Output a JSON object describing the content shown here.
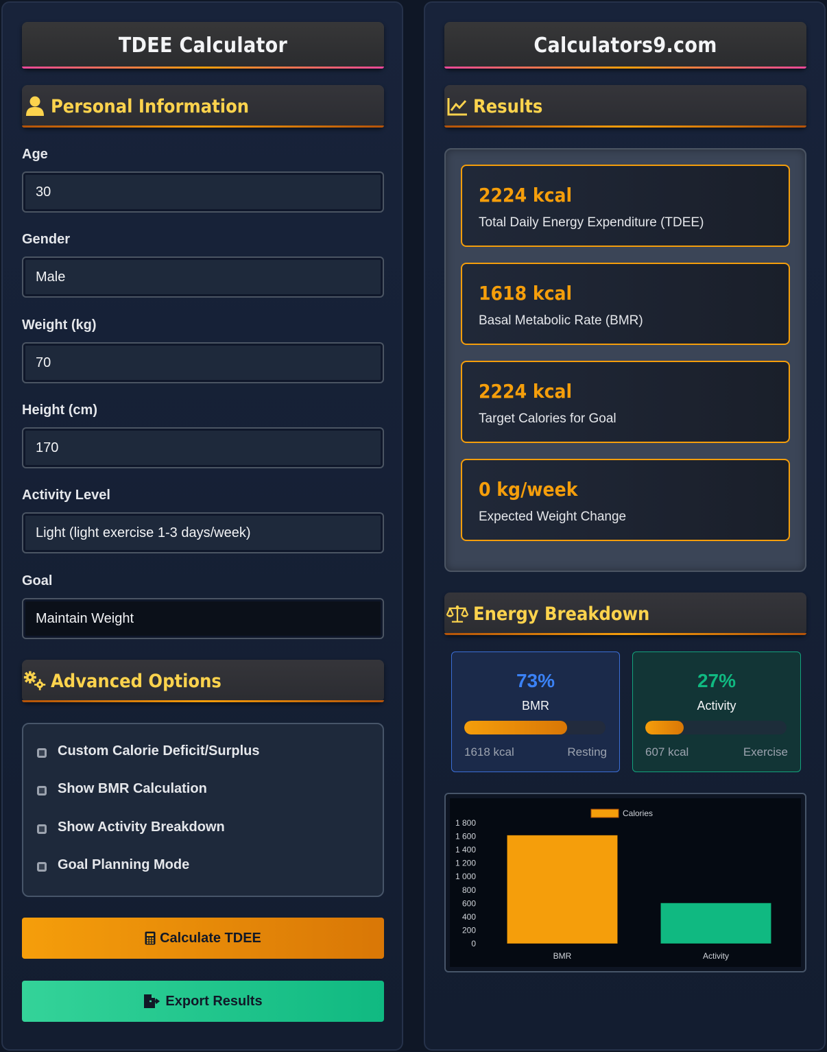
{
  "left": {
    "title": "TDEE Calculator",
    "personal_header": "Personal Information",
    "fields": [
      {
        "label": "Age",
        "value": "30"
      },
      {
        "label": "Gender",
        "value": "Male"
      },
      {
        "label": "Weight (kg)",
        "value": "70"
      },
      {
        "label": "Height (cm)",
        "value": "170"
      },
      {
        "label": "Activity Level",
        "value": "Light (light exercise 1-3 days/week)"
      },
      {
        "label": "Goal",
        "value": "Maintain Weight"
      }
    ],
    "advanced_header": "Advanced Options",
    "options": [
      {
        "label": "Custom Calorie Deficit/Surplus",
        "checked": false
      },
      {
        "label": "Show BMR Calculation",
        "checked": false
      },
      {
        "label": "Show Activity Breakdown",
        "checked": false
      },
      {
        "label": "Goal Planning Mode",
        "checked": false
      }
    ],
    "calculate_button": "Calculate TDEE",
    "export_button": "Export Results"
  },
  "right": {
    "title": "Calculators9.com",
    "results_header": "Results",
    "results": [
      {
        "value": "2224 kcal",
        "label": "Total Daily Energy Expenditure (TDEE)"
      },
      {
        "value": "1618 kcal",
        "label": "Basal Metabolic Rate (BMR)"
      },
      {
        "value": "2224 kcal",
        "label": "Target Calories for Goal"
      },
      {
        "value": "0 kg/week",
        "label": "Expected Weight Change"
      }
    ],
    "breakdown_header": "Energy Breakdown",
    "bmr_card": {
      "percent": "73%",
      "name": "BMR",
      "kcal": "1618 kcal",
      "tag": "Resting",
      "fill": 0.73
    },
    "activity_card": {
      "percent": "27%",
      "name": "Activity",
      "kcal": "607 kcal",
      "tag": "Exercise",
      "fill": 0.27
    }
  },
  "colors": {
    "accent": "#f59e0b",
    "bmr_blue": "#3b82f6",
    "activity_green": "#10b981",
    "panel_bg": "#18233a"
  },
  "chart_data": {
    "type": "bar",
    "categories": [
      "BMR",
      "Activity"
    ],
    "series": [
      {
        "name": "Calories",
        "values": [
          1618,
          607
        ],
        "colors": [
          "#f59e0b",
          "#10b981"
        ]
      }
    ],
    "ylim": [
      0,
      1800
    ],
    "yticks": [
      "1 800",
      "1 600",
      "1 400",
      "1 200",
      "1 000",
      "800",
      "600",
      "400",
      "200",
      "0"
    ],
    "legend": "top-center",
    "grid": false
  }
}
